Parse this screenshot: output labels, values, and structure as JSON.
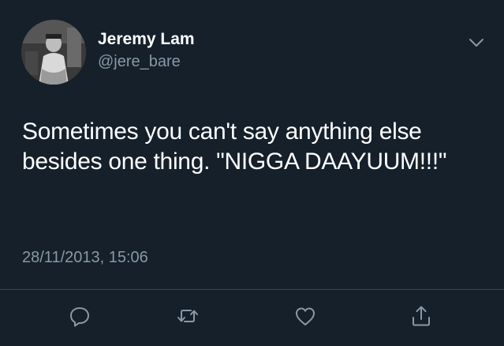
{
  "tweet": {
    "author": {
      "display_name": "Jeremy Lam",
      "handle": "@jere_bare"
    },
    "text": "Sometimes you can't say anything else besides one thing. \"NIGGA DAAYUUM!!!\"",
    "timestamp": "28/11/2013, 15:06"
  },
  "icons": {
    "more": "chevron-down-icon",
    "reply": "reply-icon",
    "retweet": "retweet-icon",
    "like": "heart-icon",
    "share": "share-icon"
  },
  "colors": {
    "background": "#15202b",
    "text_primary": "#ffffff",
    "text_secondary": "#8899a6",
    "divider": "#38444d"
  }
}
